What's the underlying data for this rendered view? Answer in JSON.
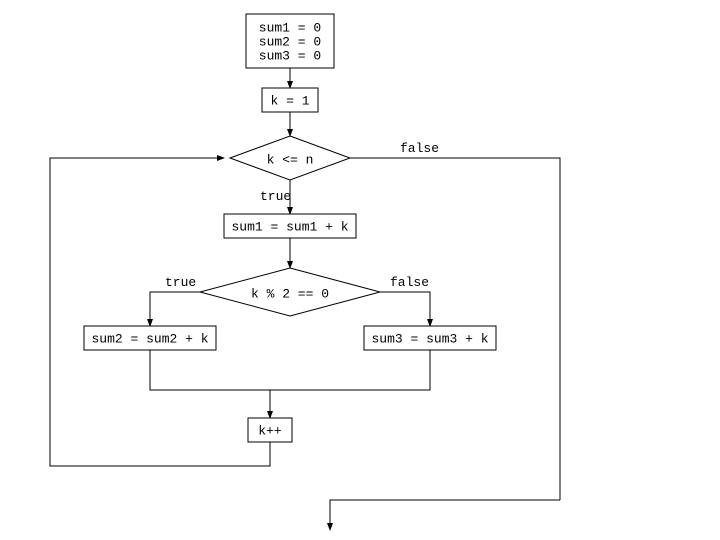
{
  "chart_data": {
    "type": "flowchart",
    "nodes": [
      {
        "id": "init",
        "shape": "rect",
        "lines": [
          "sum1 = 0",
          "sum2 = 0",
          "sum3 = 0"
        ]
      },
      {
        "id": "kinit",
        "shape": "rect",
        "text": "k = 1"
      },
      {
        "id": "cond1",
        "shape": "diamond",
        "text": "k <= n",
        "true_label": "true",
        "false_label": "false"
      },
      {
        "id": "sum1",
        "shape": "rect",
        "text": "sum1 = sum1 + k"
      },
      {
        "id": "cond2",
        "shape": "diamond",
        "text": "k % 2 == 0",
        "true_label": "true",
        "false_label": "false"
      },
      {
        "id": "sum2",
        "shape": "rect",
        "text": "sum2 = sum2 + k"
      },
      {
        "id": "sum3",
        "shape": "rect",
        "text": "sum3 = sum3 + k"
      },
      {
        "id": "kpp",
        "shape": "rect",
        "text": "k++"
      }
    ],
    "edges": [
      {
        "from": "init",
        "to": "kinit"
      },
      {
        "from": "kinit",
        "to": "cond1"
      },
      {
        "from": "cond1",
        "to": "sum1",
        "label": "true"
      },
      {
        "from": "cond1",
        "to": "exit",
        "label": "false"
      },
      {
        "from": "sum1",
        "to": "cond2"
      },
      {
        "from": "cond2",
        "to": "sum2",
        "label": "true"
      },
      {
        "from": "cond2",
        "to": "sum3",
        "label": "false"
      },
      {
        "from": "sum2",
        "to": "kpp"
      },
      {
        "from": "sum3",
        "to": "kpp"
      },
      {
        "from": "kpp",
        "to": "cond1"
      }
    ]
  },
  "labels": {
    "true": "true",
    "false": "false"
  }
}
